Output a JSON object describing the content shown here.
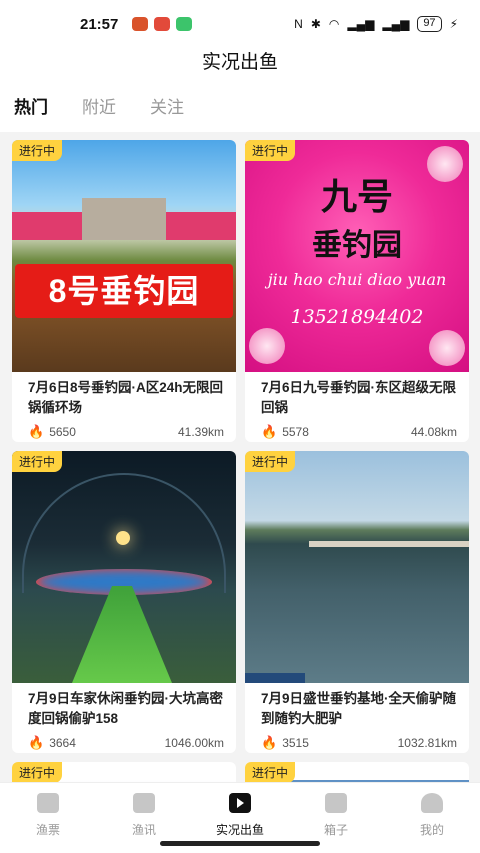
{
  "status": {
    "time": "21:57",
    "battery": "97"
  },
  "header": {
    "title": "实况出鱼"
  },
  "tabs": [
    {
      "label": "热门",
      "active": true
    },
    {
      "label": "附近",
      "active": false
    },
    {
      "label": "关注",
      "active": false
    }
  ],
  "cards": [
    {
      "badge": "进行中",
      "image_text": "8号垂钓园",
      "title": "7月6日8号垂钓园·A区24h无限回锅循环场",
      "views": "5650",
      "distance": "41.39km"
    },
    {
      "badge": "进行中",
      "image_text": [
        "九号",
        "垂钓园",
        "jiu hao chui diao yuan",
        "13521894402"
      ],
      "title": "7月6日九号垂钓园·东区超级无限回锅",
      "views": "5578",
      "distance": "44.08km"
    },
    {
      "badge": "进行中",
      "title": "7月9日车家休闲垂钓园·大坑高密度回锅偷驴158",
      "views": "3664",
      "distance": "1046.00km"
    },
    {
      "badge": "进行中",
      "title": "7月9日盛世垂钓基地·全天偷驴随到随钓大肥驴",
      "views": "3515",
      "distance": "1032.81km"
    },
    {
      "badge": "进行中"
    },
    {
      "badge": "进行中"
    }
  ],
  "nav": [
    {
      "label": "渔票",
      "icon": "ticket-icon"
    },
    {
      "label": "渔讯",
      "icon": "news-icon"
    },
    {
      "label": "实况出鱼",
      "icon": "live-play-icon",
      "active": true
    },
    {
      "label": "箱子",
      "icon": "box-icon"
    },
    {
      "label": "我的",
      "icon": "profile-icon"
    }
  ]
}
